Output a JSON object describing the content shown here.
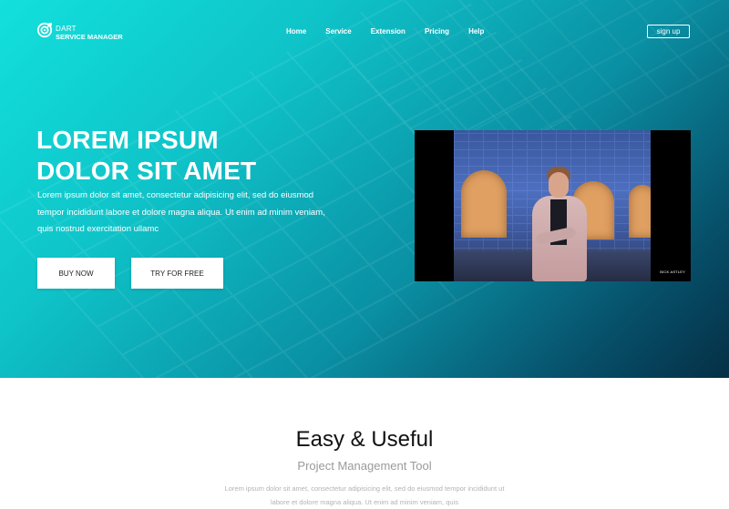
{
  "brand": {
    "line1": "DART",
    "line2": "SERVICE MANAGER",
    "icon": "target-gear-icon"
  },
  "nav": {
    "items": [
      {
        "label": "Home"
      },
      {
        "label": "Service"
      },
      {
        "label": "Extension"
      },
      {
        "label": "Pricing"
      },
      {
        "label": "Help"
      }
    ],
    "signup_label": "sign up"
  },
  "hero": {
    "title_line1": "LOREM IPSUM",
    "title_line2": "DOLOR SIT AMET",
    "description": "Lorem ipsum dolor sit amet, consectetur adipisicing elit, sed do eiusmod tempor incididunt labore et dolore magna aliqua. Ut enim ad minim veniam, quis nostrud exercitation ullamc",
    "buy_label": "BUY NOW",
    "try_label": "TRY FOR FREE",
    "video_watermark": "BICK ASTLEY"
  },
  "feature": {
    "title": "Easy & Useful",
    "subtitle": "Project Management Tool",
    "body": "Lorem ipsum dolor sit amet, consectetur adipisicing elit, sed do eiusmod tempor incididunt ut labore et dolore magna aliqua. Ut enim ad minim veniam, quis"
  },
  "colors": {
    "hero_gradient_start": "#12e0dc",
    "hero_gradient_end": "#052f45",
    "text_light": "#ffffff",
    "muted": "#9a9a9a"
  }
}
